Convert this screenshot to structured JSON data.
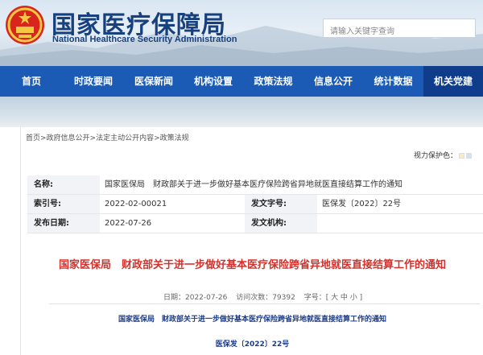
{
  "header": {
    "title": "国家医疗保障局",
    "subtitle": "National Healthcare Security Administration",
    "search_placeholder": "请输入关键字查询"
  },
  "nav": {
    "items": [
      {
        "label": "首页"
      },
      {
        "label": "时政要闻"
      },
      {
        "label": "医保新闻"
      },
      {
        "label": "机构设置"
      },
      {
        "label": "政策法规"
      },
      {
        "label": "信息公开"
      },
      {
        "label": "统计数据"
      },
      {
        "label": "机关党建"
      }
    ],
    "active_index": 7
  },
  "breadcrumb": "首页>政府信息公开>法定主动公开内容>政策法规",
  "vision": {
    "label": "视力保护色：",
    "colors": [
      "#f7efb8",
      "#cfe3f5"
    ]
  },
  "meta": {
    "name_label": "名称:",
    "name_value": "国家医保局　财政部关于进一步做好基本医疗保险跨省异地就医直接结算工作的通知",
    "index_label": "索引号:",
    "index_value": "2022-02-00021",
    "docno_label": "发文字号:",
    "docno_value": "医保发〔2022〕22号",
    "date_label": "发布日期:",
    "date_value": "2022-07-26",
    "org_label": "发文机构:",
    "org_value": ""
  },
  "article": {
    "title": "国家医保局　财政部关于进一步做好基本医疗保险跨省异地就医直接结算工作的通知",
    "date_text": "日期：2022-07-26",
    "views_text": "访问次数：79392",
    "font_size_text": "字号：[ 大 中 小 ]",
    "body_title": "国家医保局　财政部关于进一步做好基本医疗保险跨省异地就医直接结算工作的通知",
    "body_docno": "医保发〔2022〕22号"
  },
  "colors": {
    "nav_bg": "#1b5ab5",
    "nav_active": "#0f3d8c",
    "title_red": "#d2322d",
    "brand_blue": "#17407f"
  }
}
